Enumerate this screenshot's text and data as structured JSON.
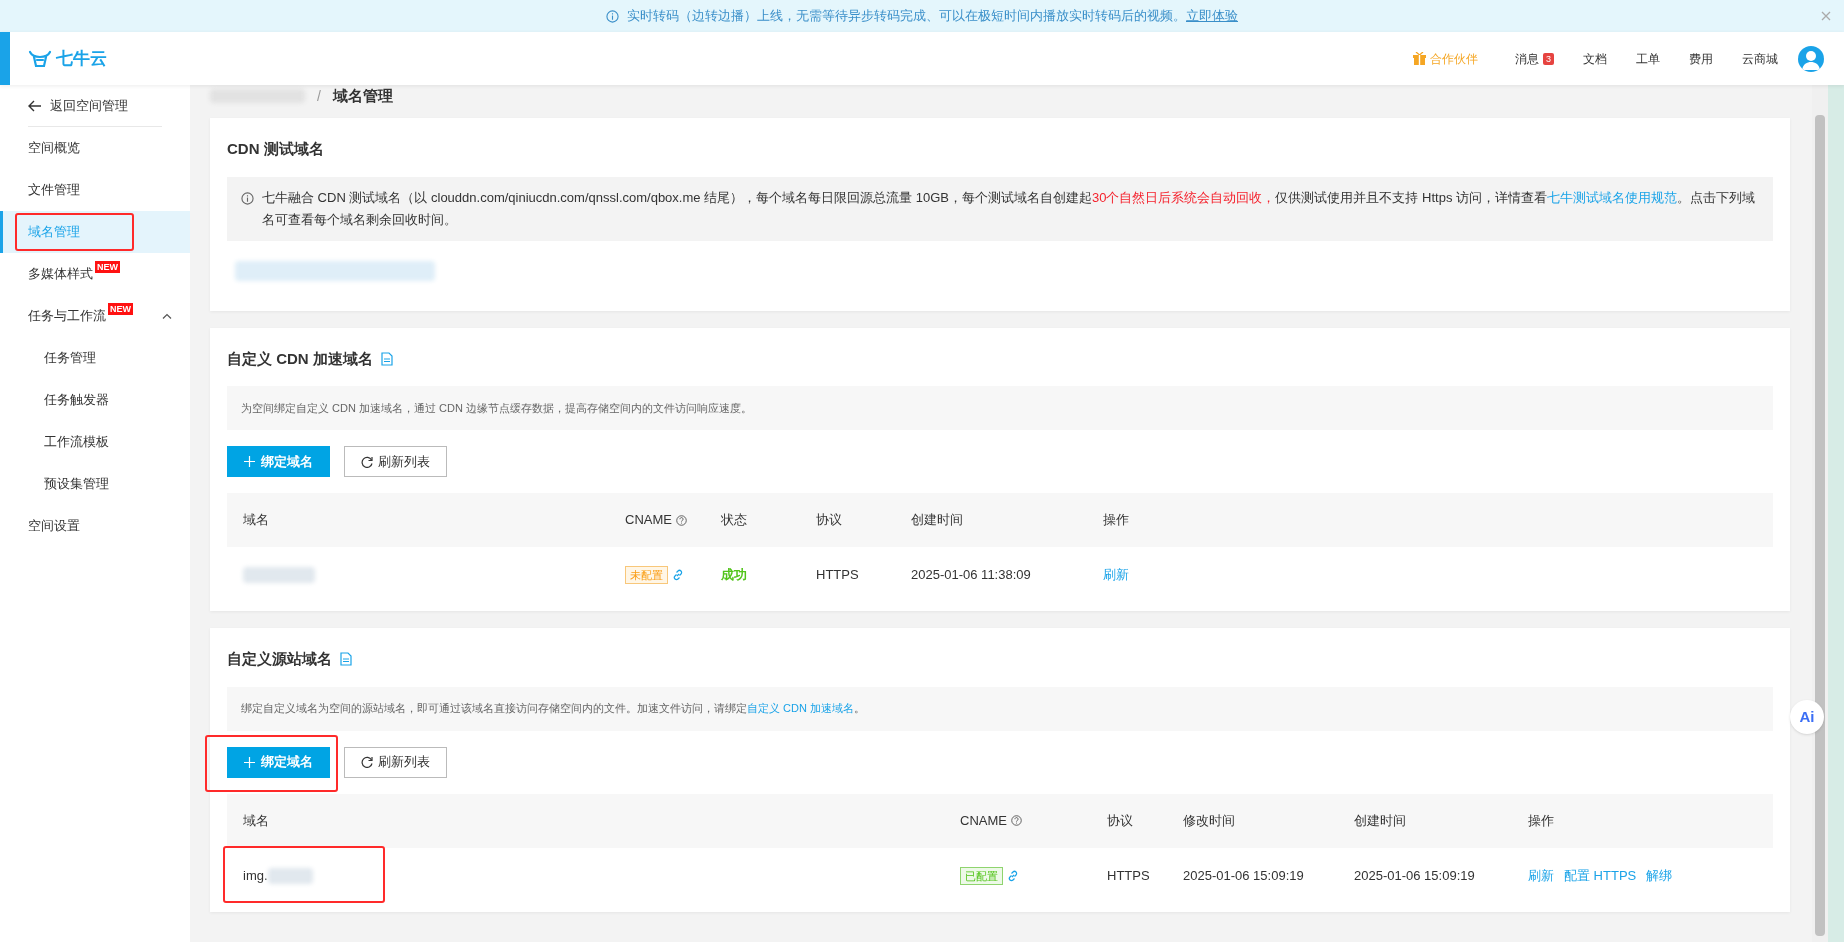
{
  "banner": {
    "text": "实时转码（边转边播）上线，无需等待异步转码完成、可以在极短时间内播放实时转码后的视频。",
    "link": "立即体验"
  },
  "header": {
    "logo": "七牛云",
    "nav": [
      {
        "label": "合作伙伴",
        "kind": "partner"
      },
      {
        "label": "消息",
        "kind": "badge",
        "badge": "3"
      },
      {
        "label": "文档",
        "kind": "plain"
      },
      {
        "label": "工单",
        "kind": "plain"
      },
      {
        "label": "费用",
        "kind": "plain"
      },
      {
        "label": "云商城",
        "kind": "plain"
      }
    ]
  },
  "sidebar": {
    "back": "返回空间管理",
    "items": [
      {
        "label": "空间概览",
        "selected": false,
        "highlighted": false
      },
      {
        "label": "文件管理",
        "selected": false,
        "highlighted": false
      },
      {
        "label": "域名管理",
        "selected": true,
        "highlighted": true
      },
      {
        "label": "多媒体样式",
        "selected": false,
        "highlighted": false,
        "badge": "NEW"
      },
      {
        "label": "任务与工作流",
        "selected": false,
        "highlighted": false,
        "badge": "NEW",
        "expanded": true,
        "children": [
          {
            "label": "任务管理",
            "selected": false,
            "highlighted": false
          },
          {
            "label": "任务触发器",
            "selected": false,
            "highlighted": false
          },
          {
            "label": "工作流模板",
            "selected": false,
            "highlighted": false
          },
          {
            "label": "预设集管理",
            "selected": false,
            "highlighted": false
          }
        ]
      },
      {
        "label": "空间设置",
        "selected": false,
        "highlighted": false
      }
    ]
  },
  "breadcrumb": {
    "separator": "/",
    "current": "域名管理"
  },
  "test_card": {
    "title": "CDN 测试域名",
    "notice": [
      {
        "kind": "plain",
        "text": "七牛融合 CDN 测试域名（以 clouddn.com/qiniucdn.com/qnssl.com/qbox.me 结尾），每个域名每日限回源总流量 10GB，每个测试域名自创建起"
      },
      {
        "kind": "alert",
        "text": "30个自然日后系统会自动回收，"
      },
      {
        "kind": "plain",
        "text": "仅供测试使用并且不支持 Https 访问，详情查看"
      },
      {
        "kind": "link",
        "text": "七牛测试域名使用规范"
      },
      {
        "kind": "plain",
        "text": "。点击下列域名可查看每个域名剩余回收时间。"
      }
    ]
  },
  "cdn_card": {
    "title": "自定义 CDN 加速域名",
    "description": [
      {
        "kind": "plain",
        "text": "为空间绑定自定义 CDN 加速域名，通过 CDN 边缘节点缓存数据，提高存储空间内的文件访问响应速度。"
      }
    ],
    "buttons": [
      {
        "label": "绑定域名",
        "kind": "primary",
        "highlighted": false
      },
      {
        "label": "刷新列表",
        "kind": "refresh",
        "highlighted": false
      }
    ],
    "columns": [
      "域名",
      "CNAME",
      "状态",
      "协议",
      "创建时间",
      "操作"
    ],
    "rows": [
      {
        "domain": "",
        "highlighted": false,
        "cname": {
          "label": "未配置",
          "configured": false
        },
        "status": "成功",
        "protocol": "HTTPS",
        "created": "2025-01-06 11:38:09",
        "actions": [
          "刷新"
        ]
      }
    ]
  },
  "source_card": {
    "title": "自定义源站域名",
    "description": [
      {
        "kind": "plain",
        "text": "绑定自定义域名为空间的源站域名，即可通过该域名直接访问存储空间内的文件。加速文件访问，请绑定"
      },
      {
        "kind": "link",
        "text": "自定义 CDN 加速域名"
      },
      {
        "kind": "plain",
        "text": "。"
      }
    ],
    "buttons": [
      {
        "label": "绑定域名",
        "kind": "primary",
        "highlighted": true
      },
      {
        "label": "刷新列表",
        "kind": "refresh",
        "highlighted": false
      }
    ],
    "columns": [
      "域名",
      "CNAME",
      "协议",
      "修改时间",
      "创建时间",
      "操作"
    ],
    "rows": [
      {
        "domain": "img.",
        "highlighted": true,
        "cname": {
          "label": "已配置",
          "configured": true
        },
        "protocol": "HTTPS",
        "modified": "2025-01-06 15:09:19",
        "created": "2025-01-06 15:09:19",
        "actions": [
          "刷新",
          "配置 HTTPS",
          "解绑"
        ]
      }
    ]
  },
  "assistant_button": "Ai"
}
